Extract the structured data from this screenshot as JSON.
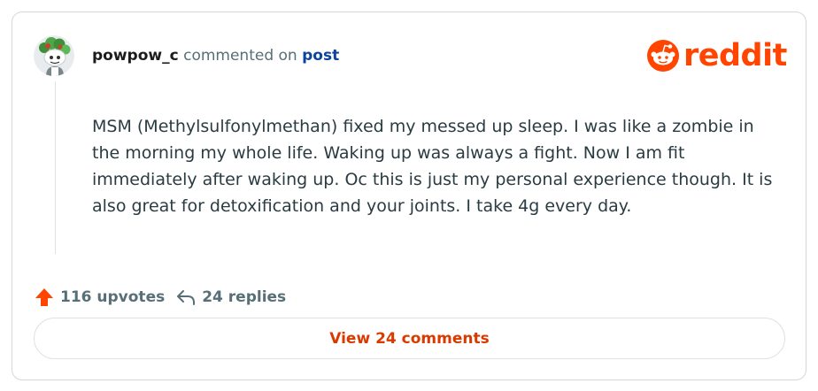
{
  "header": {
    "username": "powpow_c",
    "action_text": "commented on",
    "post_link": "post"
  },
  "logo": {
    "wordmark": "reddit",
    "icon": "reddit-snoo-icon",
    "brand_color": "#ff4500"
  },
  "comment": {
    "body": "MSM (Methylsulfonylmethan) fixed my messed up sleep. I was like a zombie in the morning my whole life. Waking up was always a fight. Now I am fit immediately after waking up. Oc this is just my personal experience though. It is also great for detoxification and your joints. I take 4g every day."
  },
  "actions": {
    "upvotes_label": "116 upvotes",
    "upvote_icon": "upvote-arrow-icon",
    "upvote_color": "#ff4500",
    "replies_label": "24 replies",
    "reply_icon": "reply-arrow-icon"
  },
  "view_comments": {
    "label": "View 24 comments",
    "color": "#d93a00"
  },
  "avatar": {
    "icon": "snoo-avatar-icon"
  }
}
